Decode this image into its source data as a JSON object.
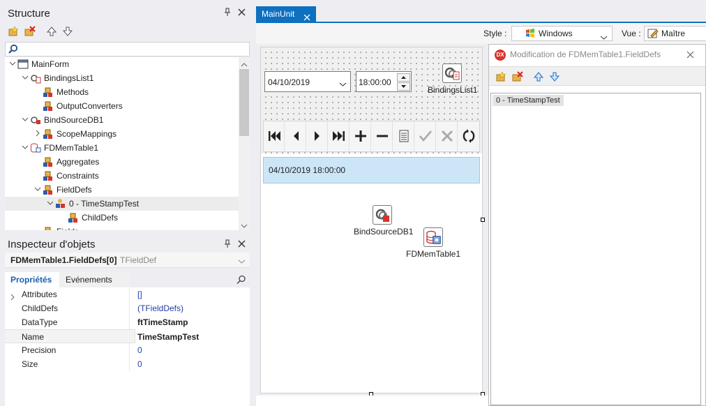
{
  "structure": {
    "title": "Structure",
    "search_placeholder": "",
    "tree": [
      {
        "label": "MainForm",
        "icon": "form-icon"
      },
      {
        "label": "BindingsList1",
        "icon": "bindings-list-icon"
      },
      {
        "label": "Methods",
        "icon": "collection-icon"
      },
      {
        "label": "OutputConverters",
        "icon": "collection-icon"
      },
      {
        "label": "BindSourceDB1",
        "icon": "bind-source-icon"
      },
      {
        "label": "ScopeMappings",
        "icon": "collection-icon"
      },
      {
        "label": "FDMemTable1",
        "icon": "mem-table-icon"
      },
      {
        "label": "Aggregates",
        "icon": "collection-icon"
      },
      {
        "label": "Constraints",
        "icon": "collection-icon"
      },
      {
        "label": "FieldDefs",
        "icon": "collection-icon"
      },
      {
        "label": "0 - TimeStampTest",
        "icon": "field-def-icon"
      },
      {
        "label": "ChildDefs",
        "icon": "collection-icon"
      },
      {
        "label": "Fields",
        "icon": "collection-icon"
      }
    ]
  },
  "inspector": {
    "title": "Inspecteur d'objets",
    "object_name": "FDMemTable1.FieldDefs[0]",
    "object_type": "TFieldDef",
    "tabs": [
      "Propriétés",
      "Evénements"
    ],
    "properties": [
      {
        "name": "Attributes",
        "value": "[]"
      },
      {
        "name": "ChildDefs",
        "value": "(TFieldDefs)"
      },
      {
        "name": "DataType",
        "value": "ftTimeStamp"
      },
      {
        "name": "Name",
        "value": "TimeStampTest"
      },
      {
        "name": "Precision",
        "value": "0"
      },
      {
        "name": "Size",
        "value": "0"
      }
    ]
  },
  "document": {
    "tab_label": "MainUnit",
    "style_label": "Style :",
    "style_value": "Windows",
    "view_label": "Vue :",
    "view_value": "Maître"
  },
  "form": {
    "date_value": "04/10/2019",
    "time_value": "18:00:00",
    "list_item": "04/10/2019 18:00:00",
    "components": {
      "bindings_list": "BindingsList1",
      "bind_source": "BindSourceDB1",
      "mem_table": "FDMemTable1"
    }
  },
  "dialog": {
    "badge": "DX",
    "title": "Modification de FDMemTable1.FieldDefs",
    "items": [
      "0 - TimeStampTest"
    ]
  },
  "colors": {
    "accent": "#0e70c0",
    "selection": "#cde6f7",
    "value_blue": "#1f3fa8"
  }
}
